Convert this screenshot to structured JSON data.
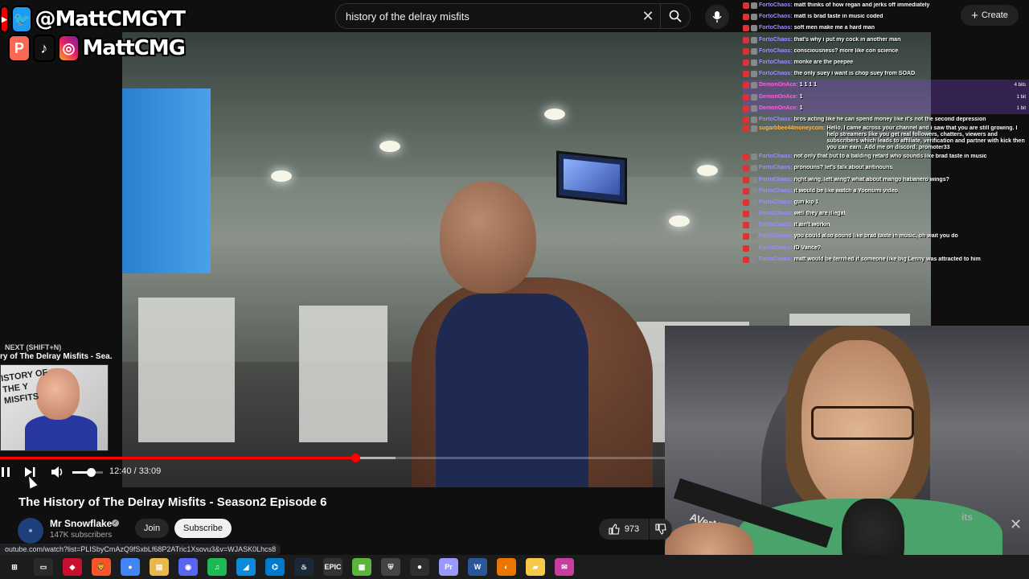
{
  "search": {
    "value": "history of the delray misfits"
  },
  "header": {
    "create_label": "Create"
  },
  "social": {
    "handle_top": "@MattCMGYT",
    "handle_bottom": "MattCMG"
  },
  "player": {
    "time_display": "12:40 / 33:09",
    "progress_fraction": 0.382,
    "volume_fraction": 0.6,
    "up_next_label": "NEXT (SHIFT+N)",
    "up_next_title": "ry of The Delray Misfits - Sea...",
    "up_next_thumb_text": "ISTORY OF THE Y MISFITS"
  },
  "video": {
    "title": "The History of The Delray Misfits - Season2 Episode 6",
    "channel": "Mr Snowflake",
    "subscribers": "147K subscribers",
    "join_label": "Join",
    "subscribe_label": "Subscribe",
    "likes": "973"
  },
  "status_url": "outube.com/watch?list=PLISbyCmAzQ9fSxbLf68P2ATric1Xsovu3&v=WJASK0Lhcs8",
  "sidebar_fragment": "its",
  "webcam": {
    "mic_brand": "AVerMedia"
  },
  "chat": [
    {
      "user": "FortoChaos:",
      "msg": "matt thinks of how regan and jerks off immediately",
      "color": "#9b8cff"
    },
    {
      "user": "FortoChaos:",
      "msg": "matt is brad taste in music coded",
      "color": "#9b8cff"
    },
    {
      "user": "FortoChaos:",
      "msg": "soft men make me a hard man",
      "color": "#9b8cff"
    },
    {
      "user": "FortoChaos:",
      "msg": "that's why i put my cock in another man",
      "color": "#9b8cff"
    },
    {
      "user": "FortoChaos:",
      "msg": "consciousness? more like con science",
      "color": "#9b8cff"
    },
    {
      "user": "FortoChaos:",
      "msg": "monke are the peepee",
      "color": "#9b8cff"
    },
    {
      "user": "FortoChaos:",
      "msg": "the only suey i want is chop suey from SOAD",
      "color": "#9b8cff"
    },
    {
      "user": "DemonOnAce:",
      "msg": "1 1 1 1",
      "color": "#ff5fd2",
      "bits": "4 bits"
    },
    {
      "user": "DemonOnAce:",
      "msg": "1",
      "color": "#ff5fd2",
      "bits": "1 bit"
    },
    {
      "user": "DemonOnAce:",
      "msg": "1",
      "color": "#ff5fd2",
      "bits": "1 bit"
    },
    {
      "user": "FortoChaos:",
      "msg": "bros acting like he can spend money like it's not the second depression",
      "color": "#9b8cff"
    },
    {
      "user": "sugarbbee44moneycom:",
      "msg": "Hello, I came across your channel and i saw that you are still growing. I help streamers like you get real followers, chatters, viewers and subscribers which leads to affiliate, verification and partner with kick then you can earn. Add me on discord: promoter33",
      "color": "#ffb347",
      "wrap": true
    },
    {
      "user": "FortoChaos:",
      "msg": "not only that but to a balding retard who sounds like brad taste in music",
      "color": "#9b8cff"
    },
    {
      "user": "FortoChaos:",
      "msg": "pronouns? let's talk about antinouns",
      "color": "#9b8cff"
    },
    {
      "user": "FortoChaos:",
      "msg": "right wing, left wing? what about mango habanero wings?",
      "color": "#9b8cff"
    },
    {
      "user": "FortoChaos:",
      "msg": "it would be like watch a Yoonumi video",
      "color": "#9b8cff"
    },
    {
      "user": "FortoChaos:",
      "msg": "gun kip 1",
      "color": "#9b8cff"
    },
    {
      "user": "FortoChaos:",
      "msg": "well they are illegal",
      "color": "#9b8cff"
    },
    {
      "user": "FortoChaos:",
      "msg": "it ain't workin",
      "color": "#9b8cff"
    },
    {
      "user": "FortoChaos:",
      "msg": "you could also sound like brad taste in music, oh wait you do",
      "color": "#9b8cff"
    },
    {
      "user": "FortoChaos:",
      "msg": "ID Vance?",
      "color": "#9b8cff"
    },
    {
      "user": "FortoChaos:",
      "msg": "matt would be terrified if someone like big Lenny was attracted to him",
      "color": "#9b8cff"
    }
  ],
  "taskbar": [
    "start",
    "task-view",
    "affinity",
    "brave",
    "chrome",
    "files",
    "discord",
    "spotify",
    "edge",
    "vscode",
    "steam",
    "epic",
    "minecraft",
    "shield",
    "obs",
    "premiere",
    "word",
    "blender",
    "notes",
    "chat"
  ]
}
